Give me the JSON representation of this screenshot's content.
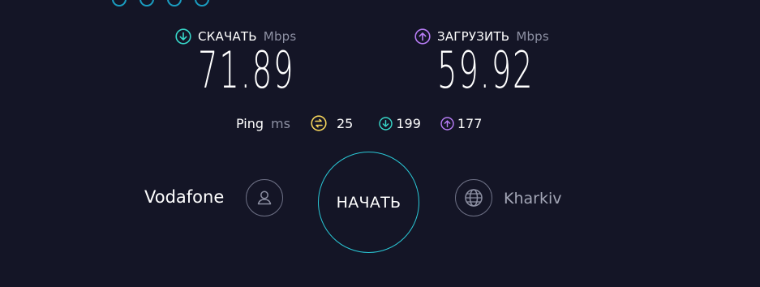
{
  "download": {
    "label": "СКАЧАТЬ",
    "unit": "Mbps",
    "value": "71.89",
    "color": "#37d7c9",
    "icon": "arrow-down-circle-icon"
  },
  "upload": {
    "label": "ЗАГРУЗИТЬ",
    "unit": "Mbps",
    "value": "59.92",
    "color": "#b77cf5",
    "icon": "arrow-up-circle-icon"
  },
  "ping": {
    "label": "Ping",
    "unit": "ms",
    "idle": "25",
    "download": "199",
    "upload": "177",
    "idle_color": "#f3d35b"
  },
  "provider": {
    "name": "Vodafone",
    "icon": "user-icon"
  },
  "start_button": {
    "label": "НАЧАТЬ",
    "ring_color": "#2ac8d6"
  },
  "server": {
    "name": "Kharkiv",
    "icon": "globe-icon"
  }
}
